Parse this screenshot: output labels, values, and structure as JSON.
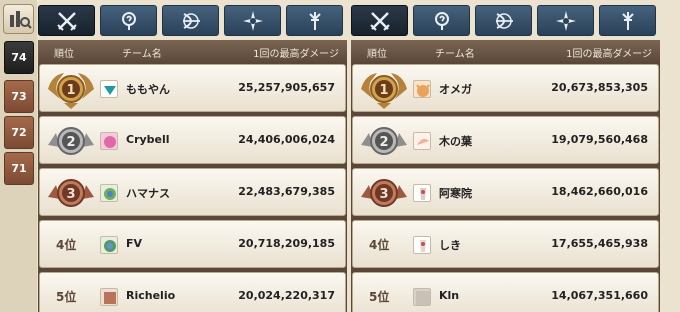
{
  "sidebar": {
    "filter_icon": "bar-chart-filter-icon",
    "seasons": [
      {
        "label": "74",
        "active": true
      },
      {
        "label": "73",
        "active": false
      },
      {
        "label": "72",
        "active": false
      },
      {
        "label": "71",
        "active": false
      }
    ]
  },
  "header": {
    "rank": "順位",
    "team": "チーム名",
    "score": "1回の最高ダメージ"
  },
  "category_tabs": [
    {
      "icon": "crossed-swords-icon",
      "active": true
    },
    {
      "icon": "magic-question-icon",
      "active": false
    },
    {
      "icon": "bow-icon",
      "active": false
    },
    {
      "icon": "compass-cross-icon",
      "active": false
    },
    {
      "icon": "spear-icon",
      "active": false
    }
  ],
  "left_panel": {
    "rows": [
      {
        "rank": "1",
        "rank_label": "",
        "team": "ももやん",
        "score": "25,257,905,657",
        "icon_color": "#1f9aa0"
      },
      {
        "rank": "2",
        "rank_label": "",
        "team": "Crybell",
        "score": "24,406,006,024",
        "icon_color": "#e06aa8"
      },
      {
        "rank": "3",
        "rank_label": "",
        "team": "ハマナス",
        "score": "22,483,679,385",
        "icon_color": "#6fae5b"
      },
      {
        "rank": "4",
        "rank_label": "4位",
        "team": "FV",
        "score": "20,718,209,185",
        "icon_color": "#4f9a66"
      },
      {
        "rank": "5",
        "rank_label": "5位",
        "team": "Richelio",
        "score": "20,024,220,317",
        "icon_color": "#b8745a"
      }
    ]
  },
  "right_panel": {
    "rows": [
      {
        "rank": "1",
        "rank_label": "",
        "team": "オメガ",
        "score": "20,673,853,305",
        "icon_color": "#e9a35c"
      },
      {
        "rank": "2",
        "rank_label": "",
        "team": "木の葉",
        "score": "19,079,560,468",
        "icon_color": "#f0b49a"
      },
      {
        "rank": "3",
        "rank_label": "",
        "team": "阿寒院",
        "score": "18,462,660,016",
        "icon_color": "#d8d0c8"
      },
      {
        "rank": "4",
        "rank_label": "4位",
        "team": "しき",
        "score": "17,655,465,938",
        "icon_color": "#e0d8d0"
      },
      {
        "rank": "5",
        "rank_label": "5位",
        "team": "Kln",
        "score": "14,067,351,660",
        "icon_color": "#c9c1b6"
      }
    ]
  },
  "colors": {
    "gold": "#c9963e",
    "silver": "#9a9a9a",
    "bronze": "#a9644a"
  }
}
